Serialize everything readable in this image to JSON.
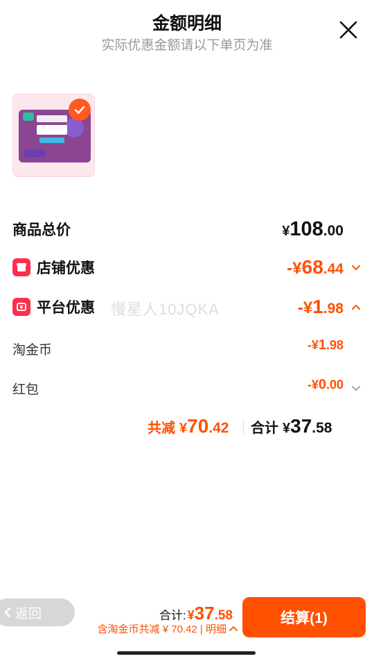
{
  "header": {
    "title": "金额明细",
    "subtitle": "实际优惠金额请以下单页为准"
  },
  "product": {
    "image_name": "乐而雅超瞬吸卫生巾"
  },
  "rows": {
    "total": {
      "label": "商品总价",
      "currency": "¥",
      "int": "108",
      "dec": ".00"
    },
    "shop": {
      "label": "店铺优惠",
      "prefix": "-¥",
      "int": "68",
      "dec": ".44"
    },
    "platform": {
      "label": "平台优惠",
      "prefix": "-¥",
      "int": "1",
      "dec": ".98"
    },
    "coin": {
      "label": "淘金币",
      "prefix": "-¥",
      "int": "1",
      "dec": ".98"
    },
    "redpacket": {
      "label": "红包",
      "prefix": "-¥",
      "int": "0",
      "dec": ".00"
    }
  },
  "summary": {
    "saved_label": "共减",
    "saved_currency": "¥",
    "saved_int": "70",
    "saved_dec": ".42",
    "total_label": "合计",
    "total_currency": "¥",
    "total_int": "37",
    "total_dec": ".58"
  },
  "watermark": "慢星人10JQKA",
  "bottom": {
    "back_label": "返回",
    "sum_label": "合计:",
    "sum_currency": "¥",
    "sum_int": "37",
    "sum_dec": ".58",
    "detail_text": "含淘金币共减 ¥ 70.42 | 明细",
    "checkout_label": "结算(1)"
  },
  "colors": {
    "accent": "#ff5000",
    "tag": "#ff2e4d"
  },
  "icons": {
    "close": "close-icon",
    "check": "check-icon",
    "chevron_down": "chevron-down-icon",
    "chevron_up": "chevron-up-icon"
  }
}
